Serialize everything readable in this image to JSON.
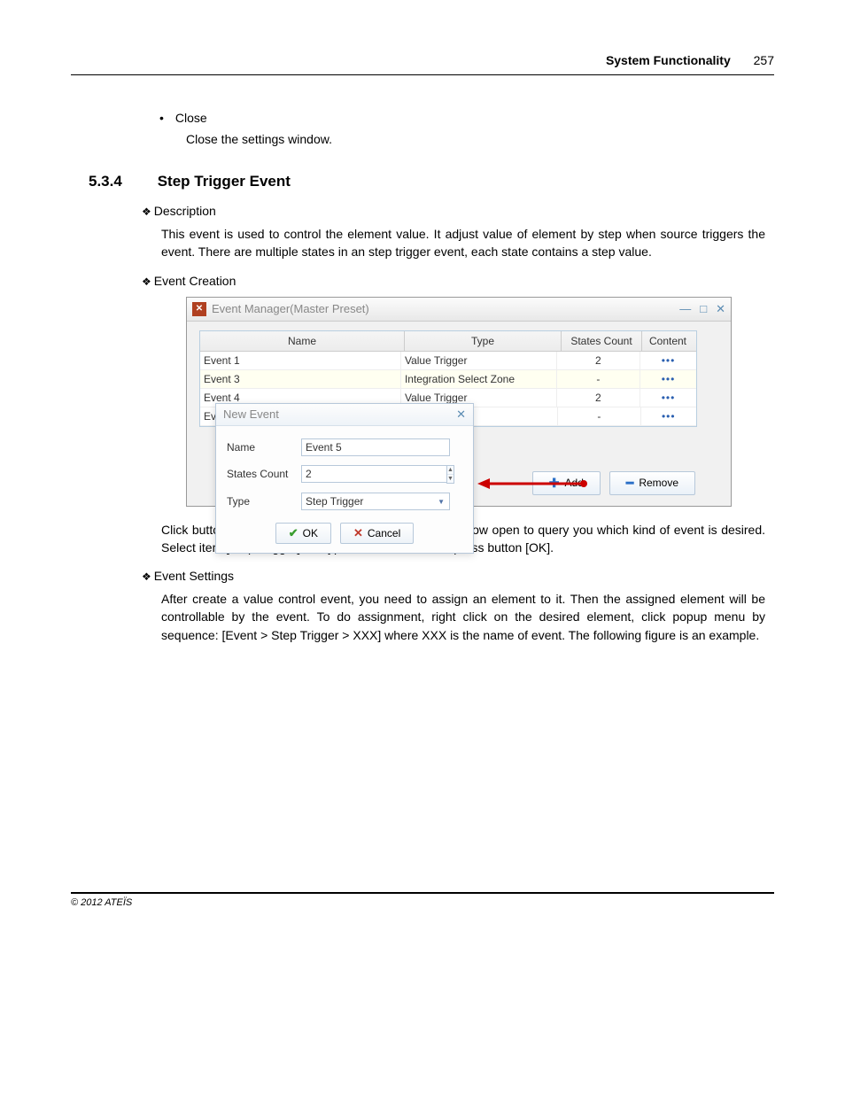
{
  "header": {
    "title": "System Functionality",
    "page": "257"
  },
  "close_block": {
    "bullet": "Close",
    "text": "Close the settings window."
  },
  "section": {
    "num": "5.3.4",
    "title": "Step Trigger Event"
  },
  "sub1": {
    "heading": "Description",
    "para": "This event is used to control the element value. It adjust value of element by step when source triggers the event. There are multiple states in an step trigger event, each state contains a step value."
  },
  "sub2": {
    "heading": "Event Creation"
  },
  "window": {
    "title": "Event Manager(Master Preset)",
    "headers": {
      "name": "Name",
      "type": "Type",
      "states": "States Count",
      "content": "Content"
    },
    "rows": [
      {
        "name": "Event 1",
        "type": "Value Trigger",
        "states": "2",
        "content": "•••"
      },
      {
        "name": "Event 3",
        "type": "Integration Select Zone",
        "states": "-",
        "content": "•••"
      },
      {
        "name": "Event 4",
        "type": "Value Trigger",
        "states": "2",
        "content": "•••"
      },
      {
        "name": "Ev",
        "type": "",
        "states": "-",
        "content": "•••"
      }
    ],
    "buttons": {
      "add": "Add",
      "remove": "Remove"
    }
  },
  "popup": {
    "title": "New Event",
    "labels": {
      "name": "Name",
      "states": "States Count",
      "type": "Type"
    },
    "values": {
      "name": "Event 5",
      "states": "2",
      "type": "Step Trigger"
    },
    "ok": "OK",
    "cancel": "Cancel"
  },
  "after_img_para": "Click button [Add] to create a new event, a second window open to query you which kind of event is desired. Select item [Step Trigger] on Type combo box. Then, press button [OK].",
  "sub3": {
    "heading": "Event Settings",
    "para": "After create a value control event, you need to assign an element to it. Then the assigned element will be controllable by the event. To do assignment, right click on the desired element, click popup menu by sequence: [Event > Step Trigger > XXX] where XXX is the name of event. The following figure is an example."
  },
  "footer": "© 2012 ATEÏS"
}
